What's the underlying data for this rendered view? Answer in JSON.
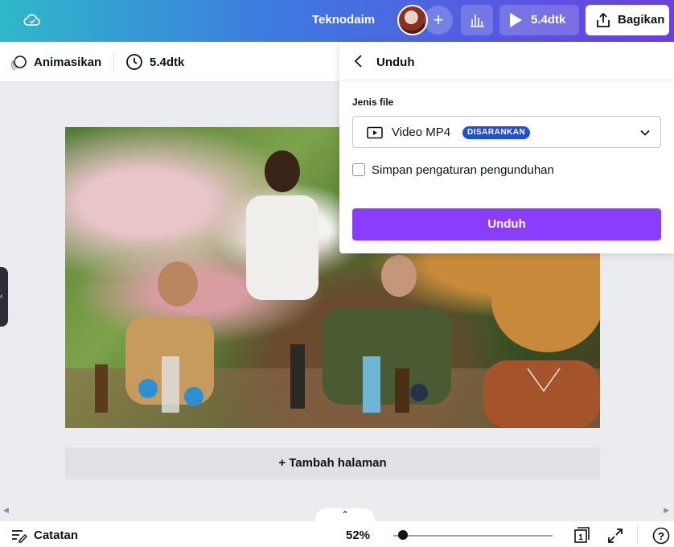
{
  "header": {
    "project_title": "Teknodaim",
    "add_collaborator": "+",
    "present_label": "5.4dtk",
    "share_label": "Bagikan"
  },
  "toolbar": {
    "animate_label": "Animasikan",
    "duration_label": "5.4dtk"
  },
  "canvas": {
    "add_page_label": "+ Tambah halaman",
    "collapse_glyph": "⌃"
  },
  "footer": {
    "notes_label": "Catatan",
    "zoom_label": "52%",
    "zoom_level": 0.06,
    "pages_count": "1",
    "help_label": "?"
  },
  "download_panel": {
    "title": "Unduh",
    "file_type_label": "Jenis file",
    "file_type_value": "Video MP4",
    "recommended_badge": "DISARANKAN",
    "save_settings_label": "Simpan pengaturan pengunduhan",
    "save_settings_checked": false,
    "download_button_label": "Unduh"
  },
  "colors": {
    "accent_purple": "#8b3dff",
    "badge_blue": "#1d4fd8",
    "header_gradient": [
      "#2fb8c8",
      "#3d7be0",
      "#6b3fe0"
    ]
  },
  "icons": [
    "cloud-check-icon",
    "plus-icon",
    "bar-chart-icon",
    "play-icon",
    "share-upload-icon",
    "animate-icon",
    "clock-icon",
    "back-arrow-icon",
    "video-icon",
    "chevron-down-icon",
    "notes-icon",
    "pages-icon",
    "fullscreen-icon",
    "help-icon"
  ]
}
